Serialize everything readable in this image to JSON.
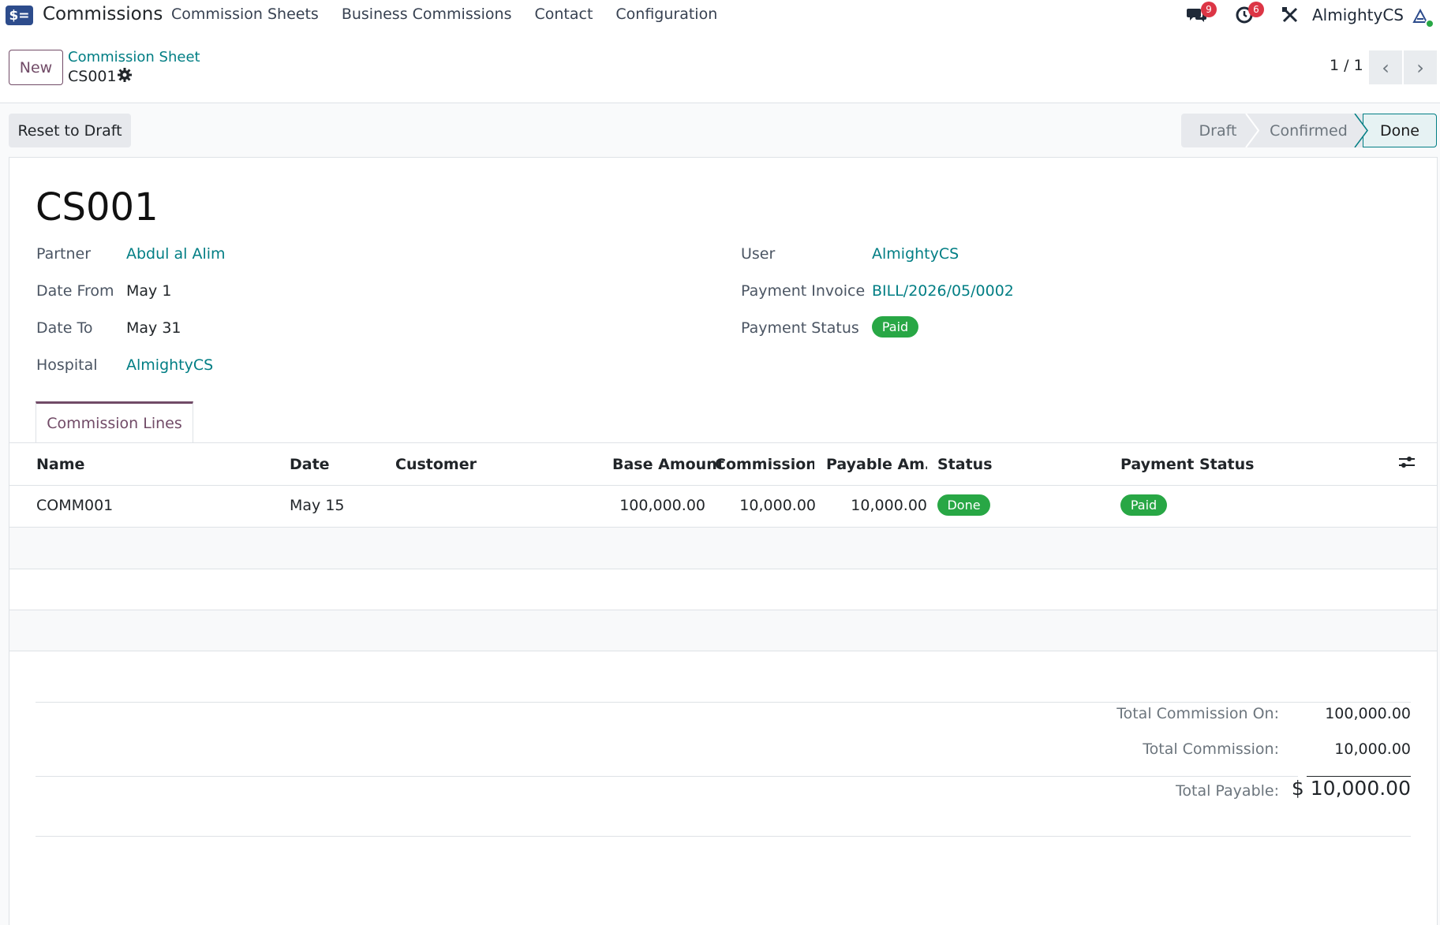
{
  "navbar": {
    "app_logo": "$=",
    "app_title": "Commissions",
    "menu": [
      "Commission Sheets",
      "Business Commissions",
      "Contact",
      "Configuration"
    ],
    "messages_count": "9",
    "activities_count": "6",
    "user_name": "AlmightyCS",
    "icons": {
      "messages": "chat-icon",
      "activities": "clock-icon",
      "debug": "tools-icon"
    }
  },
  "control_panel": {
    "new_label": "New",
    "breadcrumb": "Commission Sheet",
    "record_name": "CS001",
    "pager": "1 / 1"
  },
  "actions": {
    "reset_label": "Reset to Draft",
    "steps": [
      "Draft",
      "Confirmed",
      "Done"
    ],
    "active_step": "Done"
  },
  "form": {
    "title": "CS001",
    "left": {
      "partner_label": "Partner",
      "partner": "Abdul al Alim",
      "date_from_label": "Date From",
      "date_from": "May 1",
      "date_to_label": "Date To",
      "date_to": "May 31",
      "hospital_label": "Hospital",
      "hospital": "AlmightyCS"
    },
    "right": {
      "user_label": "User",
      "user": "AlmightyCS",
      "invoice_label": "Payment Invoice",
      "invoice": "BILL/2026/05/0002",
      "payment_status_label": "Payment Status",
      "payment_status": "Paid"
    }
  },
  "tab": {
    "label": "Commission Lines"
  },
  "table": {
    "columns": [
      "Name",
      "Date",
      "Customer",
      "Base Amount",
      "Commission…",
      "Payable Am…",
      "Status",
      "Payment Status"
    ],
    "rows": [
      {
        "name": "COMM001",
        "date": "May 15",
        "customer": "",
        "base": "100,000.00",
        "commission": "10,000.00",
        "payable": "10,000.00",
        "status": "Done",
        "payment_status": "Paid"
      }
    ]
  },
  "totals": {
    "commission_on_label": "Total Commission On:",
    "commission_on": "100,000.00",
    "commission_label": "Total Commission:",
    "commission": "10,000.00",
    "payable_label": "Total Payable:",
    "payable": "$ 10,000.00"
  },
  "colors": {
    "brand": "#714b67",
    "link": "#017e84",
    "success": "#28a745",
    "danger": "#dc3545"
  }
}
